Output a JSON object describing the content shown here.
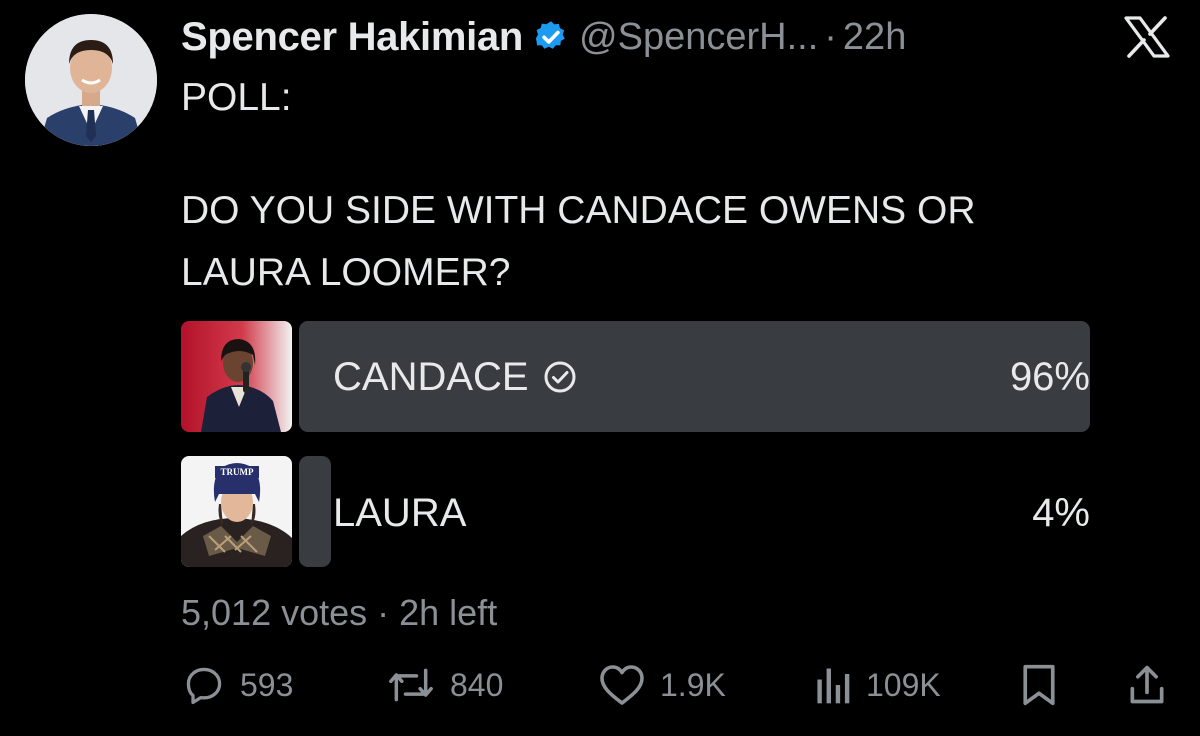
{
  "author": {
    "name": "Spencer Hakimian",
    "handle": "@SpencerH...",
    "separator": "·",
    "time": "22h",
    "avatar_icon": "person-avatar",
    "verified_icon": "verified-badge-icon",
    "verified_color": "#1d9bf0"
  },
  "brand": {
    "logo_icon": "x-logo-icon"
  },
  "post": {
    "line1": "POLL:",
    "line2": "DO YOU SIDE WITH CANDACE OWENS OR",
    "line3": "LAURA LOOMER?"
  },
  "poll": {
    "options": [
      {
        "label": "CANDACE",
        "percent_label": "96%",
        "percent": 96,
        "selected": true,
        "thumb_icon": "candace-photo"
      },
      {
        "label": "LAURA",
        "percent_label": "4%",
        "percent": 4,
        "selected": false,
        "thumb_icon": "laura-photo",
        "hat_text": "TRUMP"
      }
    ],
    "meta": "5,012 votes · 2h left"
  },
  "actions": {
    "reply": {
      "count": "593",
      "icon": "reply-icon"
    },
    "repost": {
      "count": "840",
      "icon": "repost-icon"
    },
    "like": {
      "count": "1.9K",
      "icon": "heart-icon"
    },
    "views": {
      "count": "109K",
      "icon": "views-icon"
    },
    "bookmark": {
      "icon": "bookmark-icon"
    },
    "share": {
      "icon": "share-icon"
    }
  },
  "colors": {
    "background": "#000000",
    "text": "#e7e9ea",
    "muted": "#8b9096",
    "bar": "#393c41"
  }
}
